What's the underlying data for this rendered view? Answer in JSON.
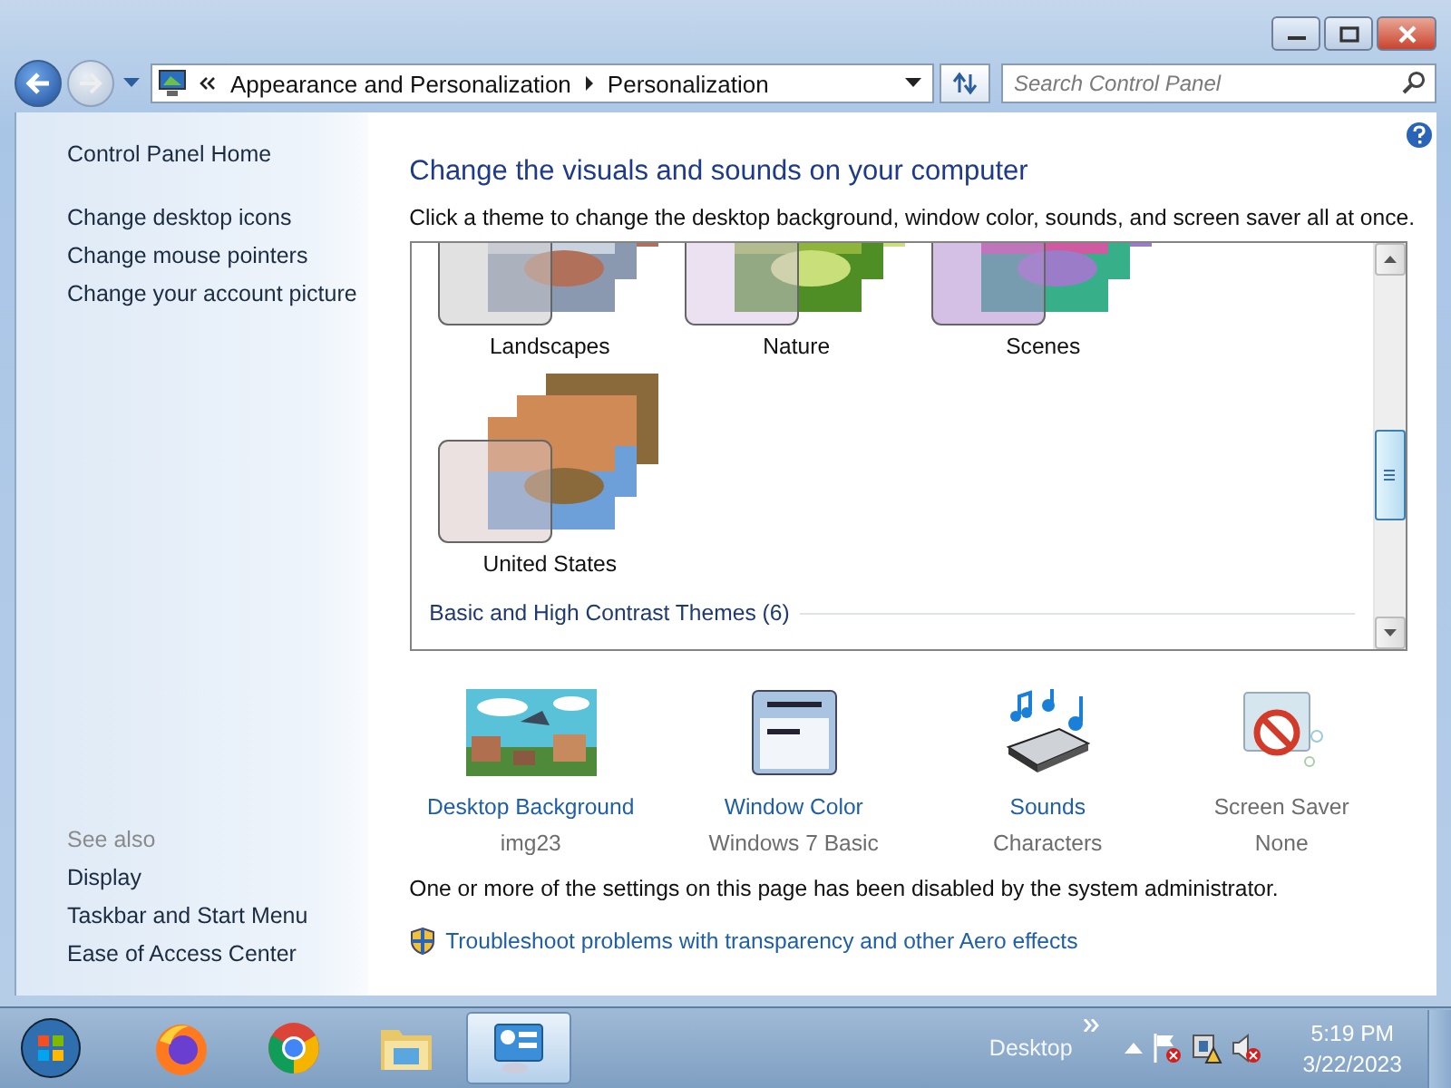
{
  "address_bar": {
    "crumbs": [
      "Appearance and Personalization",
      "Personalization"
    ]
  },
  "search": {
    "placeholder": "Search Control Panel"
  },
  "sidebar": {
    "items": [
      "Control Panel Home",
      "Change desktop icons",
      "Change mouse pointers",
      "Change your account picture"
    ],
    "see_also": {
      "heading": "See also",
      "items": [
        "Display",
        "Taskbar and Start Menu",
        "Ease of Access Center"
      ]
    }
  },
  "main": {
    "title": "Change the visuals and sounds on your computer",
    "description": "Click a theme to change the desktop background, window color, sounds, and screen saver all at once."
  },
  "themes": {
    "items": [
      {
        "name": "Landscapes",
        "kind": "picture"
      },
      {
        "name": "Nature",
        "kind": "picture"
      },
      {
        "name": "Scenes",
        "kind": "picture"
      },
      {
        "name": "United States",
        "kind": "picture"
      }
    ],
    "group_header": "Basic and High Contrast Themes (6)"
  },
  "settings": [
    {
      "kind": "background",
      "label": "Desktop Background",
      "value": "img23",
      "disabled": false
    },
    {
      "kind": "color",
      "label": "Window Color",
      "value": "Windows 7 Basic",
      "disabled": false
    },
    {
      "kind": "sounds",
      "label": "Sounds",
      "value": "Characters",
      "disabled": false
    },
    {
      "kind": "screensaver",
      "label": "Screen Saver",
      "value": "None",
      "disabled": true
    }
  ],
  "notice": "One or more of the settings on this page has been disabled by the system administrator.",
  "troubleshoot_link": "Troubleshoot problems with transparency and other Aero effects",
  "taskbar": {
    "apps": [
      {
        "kind": "firefox",
        "selected": false
      },
      {
        "kind": "chrome",
        "selected": false
      },
      {
        "kind": "explorer",
        "selected": false
      },
      {
        "kind": "control-panel",
        "selected": true
      }
    ],
    "toolbar": "Desktop",
    "time": "5:19 PM",
    "date": "3/22/2023"
  }
}
